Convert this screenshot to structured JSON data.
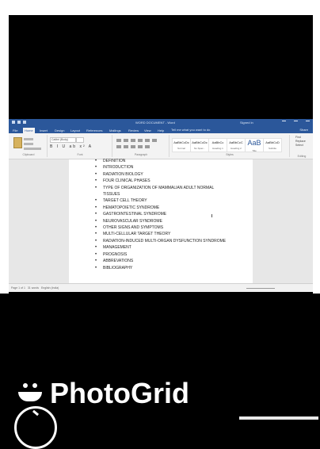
{
  "app": {
    "doc_title": "WORD DOCUMENT - Word",
    "user": "Signed in"
  },
  "tabs": [
    {
      "label": "File"
    },
    {
      "label": "Home",
      "active": true
    },
    {
      "label": "Insert"
    },
    {
      "label": "Design"
    },
    {
      "label": "Layout"
    },
    {
      "label": "References"
    },
    {
      "label": "Mailings"
    },
    {
      "label": "Review"
    },
    {
      "label": "View"
    },
    {
      "label": "Help"
    }
  ],
  "ribbon": {
    "tell_me": "Tell me what you want to do",
    "share_label": "Share",
    "groups": {
      "clipboard": "Clipboard",
      "font": "Font",
      "paragraph": "Paragraph",
      "styles": "Styles",
      "editing": "Editing"
    },
    "font_name": "Calibri (Body)",
    "styles": [
      {
        "sample": "AaBbCcDc",
        "name": "Normal"
      },
      {
        "sample": "AaBbCcDc",
        "name": "No Spac..."
      },
      {
        "sample": "AaBbCc",
        "name": "Heading 1"
      },
      {
        "sample": "AaBbCcC",
        "name": "Heading 2"
      },
      {
        "sample": "AaB",
        "name": "Title",
        "big": true
      },
      {
        "sample": "AaBbCcD",
        "name": "Subtitle"
      }
    ],
    "editing_items": [
      "Find",
      "Replace",
      "Select"
    ]
  },
  "document": {
    "items": [
      "DEFINITION",
      "INTRODUCTION",
      "RADIATION BIOLOGY",
      "FOUR CLINICAL PHASES",
      "TYPE OF ORGANIZATION OF MAMMALIAN ADULT NORMAL TISSUES",
      "TARGET CELL THEORY",
      "HEMATOPOIETIC SYNDROME",
      "GASTROINTESTINAL SYNDROME",
      "NEUROVASCULAR SYNDROME",
      "OTHER SIGNS AND SYMPTOMS",
      "MULTI-CELLULAR TARGET THEORY",
      "RADIATION-INDUCED MULTI-ORGAN DYSFUNCTION SYNDROME",
      "MANAGEMENT",
      "PROGNOSIS",
      "ABBREVATIONS",
      "BIBLIOGRAPHY"
    ]
  },
  "status": {
    "page": "Page 1 of 1",
    "words": "31 words",
    "language": "English (India)"
  },
  "overlay": {
    "brand": "PhotoGrid"
  }
}
